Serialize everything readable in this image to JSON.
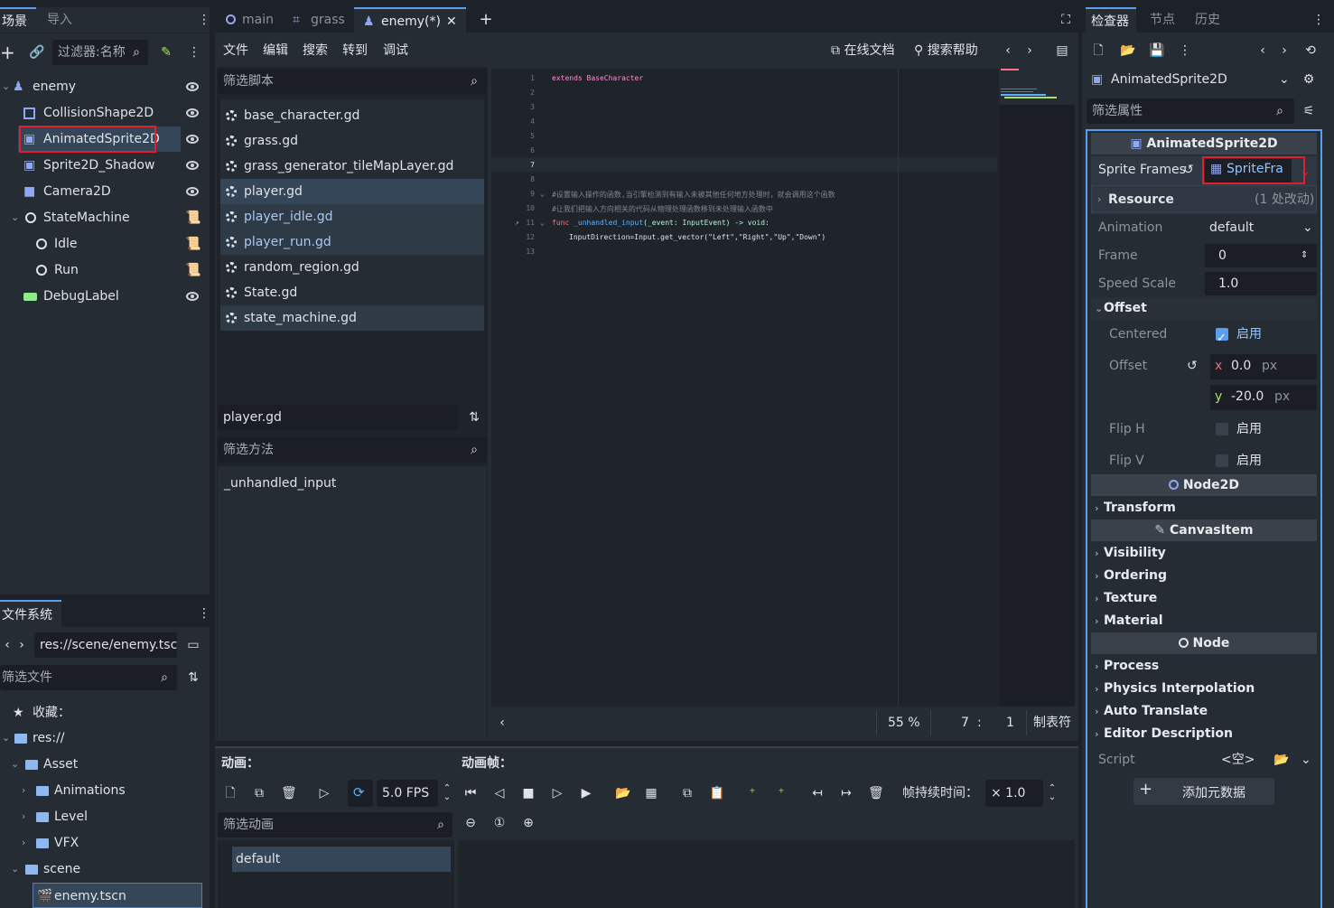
{
  "left_dock": {
    "tabs": [
      "场景",
      "导入"
    ],
    "filter_placeholder": "过滤器:名称",
    "tree": [
      {
        "label": "enemy",
        "type": "root"
      },
      {
        "label": "CollisionShape2D"
      },
      {
        "label": "AnimatedSprite2D",
        "selected": true
      },
      {
        "label": "Sprite2D_Shadow"
      },
      {
        "label": "Camera2D"
      },
      {
        "label": "StateMachine"
      },
      {
        "label": "Idle"
      },
      {
        "label": "Run"
      },
      {
        "label": "DebugLabel"
      }
    ]
  },
  "filesystem": {
    "title": "文件系统",
    "path": "res://scene/enemy.tscn",
    "filter_placeholder": "筛选文件",
    "items": [
      {
        "label": "收藏："
      },
      {
        "label": "res://"
      },
      {
        "label": "Asset"
      },
      {
        "label": "Animations"
      },
      {
        "label": "Level"
      },
      {
        "label": "VFX"
      },
      {
        "label": "scene"
      },
      {
        "label": "enemy.tscn",
        "selected": true
      }
    ]
  },
  "editor_tabs": [
    {
      "label": "main"
    },
    {
      "label": "grass"
    },
    {
      "label": "enemy(*)",
      "active": true
    }
  ],
  "script_menu": [
    "文件",
    "编辑",
    "搜索",
    "转到",
    "调试"
  ],
  "script_toolbar": {
    "online_docs": "在线文档",
    "search_help": "搜索帮助"
  },
  "script_list": {
    "filter_placeholder": "筛选脚本",
    "items": [
      "base_character.gd",
      "grass.gd",
      "grass_generator_tileMapLayer.gd",
      "player.gd",
      "player_idle.gd",
      "player_run.gd",
      "random_region.gd",
      "State.gd",
      "state_machine.gd"
    ],
    "current": "player.gd",
    "method_filter_placeholder": "筛选方法",
    "methods": [
      "_unhandled_input"
    ]
  },
  "code": {
    "line_numbers": [
      "1",
      "2",
      "3",
      "4",
      "5",
      "6",
      "7",
      "8",
      "9",
      "10",
      "11",
      "12",
      "13"
    ],
    "line1": "extends BaseCharacter",
    "line9": "#设置输入操作的函数,当引擎检测到有输入未被其他任何地方处理时，就会调用这个函数",
    "line10": "#让我们把输入方向相关的代码从物理处理函数移到未处理输入函数中",
    "line11_kw": "func",
    "line11_name": "_unhandled_input",
    "line11_args": "(_event: InputEvent) -> void:",
    "line12": "InputDirection=Input.get_vector(\"Left\",\"Right\",\"Up\",\"Down\")"
  },
  "status_bar": {
    "zoom": "55 %",
    "line": "7",
    "col": "1",
    "indent": "制表符"
  },
  "bottom_panel": {
    "animations_label": "动画：",
    "frames_label": "动画帧：",
    "fps": "5.0 FPS",
    "duration_label": "帧持续时间：",
    "duration": "× 1.0",
    "filter_placeholder": "筛选动画",
    "animations": [
      "default"
    ]
  },
  "inspector": {
    "tabs": [
      "检查器",
      "节点",
      "历史"
    ],
    "object": "AnimatedSprite2D",
    "filter_placeholder": "筛选属性",
    "class_header": "AnimatedSprite2D",
    "sprite_frames_label": "Sprite Frames",
    "sprite_frames_value": "SpriteFra",
    "resource_label": "Resource",
    "resource_changes": "(1 处改动)",
    "animation_label": "Animation",
    "animation_value": "default",
    "frame_label": "Frame",
    "frame_value": "0",
    "speed_label": "Speed Scale",
    "speed_value": "1.0",
    "offset_section": "Offset",
    "centered_label": "Centered",
    "centered_value": "启用",
    "offset_label": "Offset",
    "offset_x_axis": "x",
    "offset_x": "0.0",
    "offset_y_axis": "y",
    "offset_y": "-20.0",
    "unit": "px",
    "fliph_label": "Flip H",
    "fliph_value": "启用",
    "flipv_label": "Flip V",
    "flipv_value": "启用",
    "node2d_header": "Node2D",
    "transform": "Transform",
    "canvasitem_header": "CanvasItem",
    "visibility": "Visibility",
    "ordering": "Ordering",
    "texture": "Texture",
    "material": "Material",
    "node_header": "Node",
    "process": "Process",
    "physics_interp": "Physics Interpolation",
    "auto_translate": "Auto Translate",
    "editor_desc": "Editor Description",
    "script_label": "Script",
    "script_value": "<空>",
    "add_metadata": "添加元数据"
  }
}
